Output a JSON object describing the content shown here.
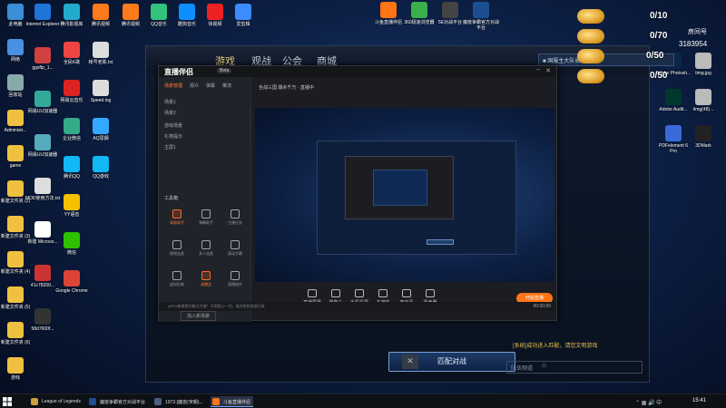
{
  "desktop_left": [
    {
      "label": "此电脑",
      "color": "#3a8fd8"
    },
    {
      "label": "网络",
      "color": "#4a90e2"
    },
    {
      "label": "回收站",
      "color": "#8aa"
    },
    {
      "label": "Administr...",
      "color": "#f0c040"
    },
    {
      "label": "game",
      "color": "#f0c040"
    },
    {
      "label": "新建文件夹 (2)",
      "color": "#f0c040"
    },
    {
      "label": "新建文件夹 (3)",
      "color": "#f0c040"
    },
    {
      "label": "新建文件夹 (4)",
      "color": "#f0c040"
    },
    {
      "label": "新建文件夹 (5)",
      "color": "#f0c040"
    },
    {
      "label": "新建文件夹 (6)",
      "color": "#f0c040"
    },
    {
      "label": "游戏",
      "color": "#f0c040"
    }
  ],
  "desktop_col2": [
    {
      "label": "Internet Explorer",
      "color": "#1e74d8"
    },
    {
      "label": "ggsftp_1...",
      "color": "#d04040"
    },
    {
      "label": "网易UU加速器",
      "color": "#3a9"
    },
    {
      "label": "网易UU加速器",
      "color": "#5ab"
    },
    {
      "label": "MOD使用方法.txt",
      "color": "#ddd"
    },
    {
      "label": "新建 Microso...",
      "color": "#fff"
    },
    {
      "label": "41c78200...",
      "color": "#c33"
    },
    {
      "label": "58d7600f...",
      "color": "#333"
    }
  ],
  "desktop_col3": [
    {
      "label": "腾讯影视库",
      "color": "#2ac"
    },
    {
      "label": "全民K歌",
      "color": "#e44"
    },
    {
      "label": "网易云音乐",
      "color": "#d22"
    },
    {
      "label": "企业微信",
      "color": "#3a8"
    },
    {
      "label": "腾讯QQ",
      "color": "#12b7f5"
    },
    {
      "label": "YY语音",
      "color": "#f5c000"
    },
    {
      "label": "微信",
      "color": "#2dc100"
    },
    {
      "label": "Google Chrome",
      "color": "#db4437"
    }
  ],
  "desktop_col4": [
    {
      "label": "腾讯视频",
      "color": "#ff7a1a"
    },
    {
      "label": "帐号老陈.txt",
      "color": "#ddd"
    },
    {
      "label": "Speed.log",
      "color": "#ddd"
    },
    {
      "label": "AQ思搁",
      "color": "#3af"
    },
    {
      "label": "QQ游戏",
      "color": "#12b7f5"
    }
  ],
  "desktop_top": [
    {
      "label": "腾讯视频",
      "color": "#ff7a1a"
    },
    {
      "label": "QQ音乐",
      "color": "#31c27c"
    },
    {
      "label": "酷狗音乐",
      "color": "#0f8fff"
    },
    {
      "label": "快视频",
      "color": "#e22"
    },
    {
      "label": "爱剪辑",
      "color": "#3a8cff"
    }
  ],
  "desktop_top_mid": [
    {
      "label": "斗鱼直播伴侣",
      "color": "#ff7414"
    },
    {
      "label": "360极速浏览器",
      "color": "#3ab04a"
    },
    {
      "label": "5E对战平台",
      "color": "#444"
    },
    {
      "label": "魔兽争霸官方对战平台",
      "color": "#1d4f90"
    }
  ],
  "desktop_right": [
    {
      "label": "Adobe Photosh...",
      "color": "#0b2648"
    },
    {
      "label": "timg.jpg",
      "color": "#bbb"
    },
    {
      "label": "Adobe Audit...",
      "color": "#00382e"
    },
    {
      "label": "timg(48)...",
      "color": "#bbb"
    },
    {
      "label": "PDFelement 6 Pro",
      "color": "#3a6ad8"
    },
    {
      "label": "3DMark",
      "color": "#222"
    }
  ],
  "overlay": {
    "stats": [
      "0/10",
      "0/70",
      "0/50",
      "0/50"
    ],
    "fans_label": "房间号",
    "room_number": "3183954"
  },
  "game_client": {
    "nav": {
      "game": "游戏",
      "watch": "观战",
      "guild": "公会",
      "mall": "商城"
    },
    "banner": "■ 国服主大队长xuan ...",
    "match_button": "匹配对战",
    "match_close": "✕",
    "system_message": "[系统]成功进入匹配，请您文明游戏",
    "chat_placeholder": "队伍频道",
    "chat_emoji": "☺"
  },
  "stream_app": {
    "logo": "直播伴侣",
    "badge": "Beta",
    "tabs": [
      "场景管理",
      "观众",
      "弹幕",
      "推流"
    ],
    "sources": [
      "场景1",
      "场景2",
      "游戏场景",
      "礼物提示",
      "主屏1"
    ],
    "room_title": "全战三国 爆杀千万 · 直播中",
    "tools_title": "工具箱",
    "tools": [
      {
        "label": "录屏助手",
        "on": true
      },
      {
        "label": "弹幕助手",
        "on": false
      },
      {
        "label": "主播任务",
        "on": false
      },
      {
        "label": "视频连麦",
        "on": false
      },
      {
        "label": "多人连麦",
        "on": false
      },
      {
        "label": "滚动字幕",
        "on": false
      },
      {
        "label": "虚拟形象",
        "on": false
      },
      {
        "label": "录播宝",
        "on": true
      },
      {
        "label": "直播插件",
        "on": false
      }
    ],
    "add_scene": "加入新场景",
    "controls": [
      "直播屏幕",
      "摄像头",
      "手机投屏",
      "多媒体",
      "麦克风",
      "扬声器"
    ],
    "start_live": "开始直播",
    "status_text": "APEX新赛季功能大开放！不用担心一切，高光时刻全部记录",
    "status_time": "00:00:00"
  },
  "taskbar": {
    "items": [
      {
        "label": "League of Legends",
        "color": "#c8a040",
        "active": false
      },
      {
        "label": "魔兽争霸官方对战平台",
        "color": "#1d4f90",
        "active": false
      },
      {
        "label": "1972-[魔兽(宋朝)...",
        "color": "#4a6080",
        "active": false
      },
      {
        "label": "斗鱼直播伴侣",
        "color": "#ff7414",
        "active": true
      }
    ],
    "tray": "⌃ ▦ 🔊 中",
    "clock": "15:41"
  }
}
